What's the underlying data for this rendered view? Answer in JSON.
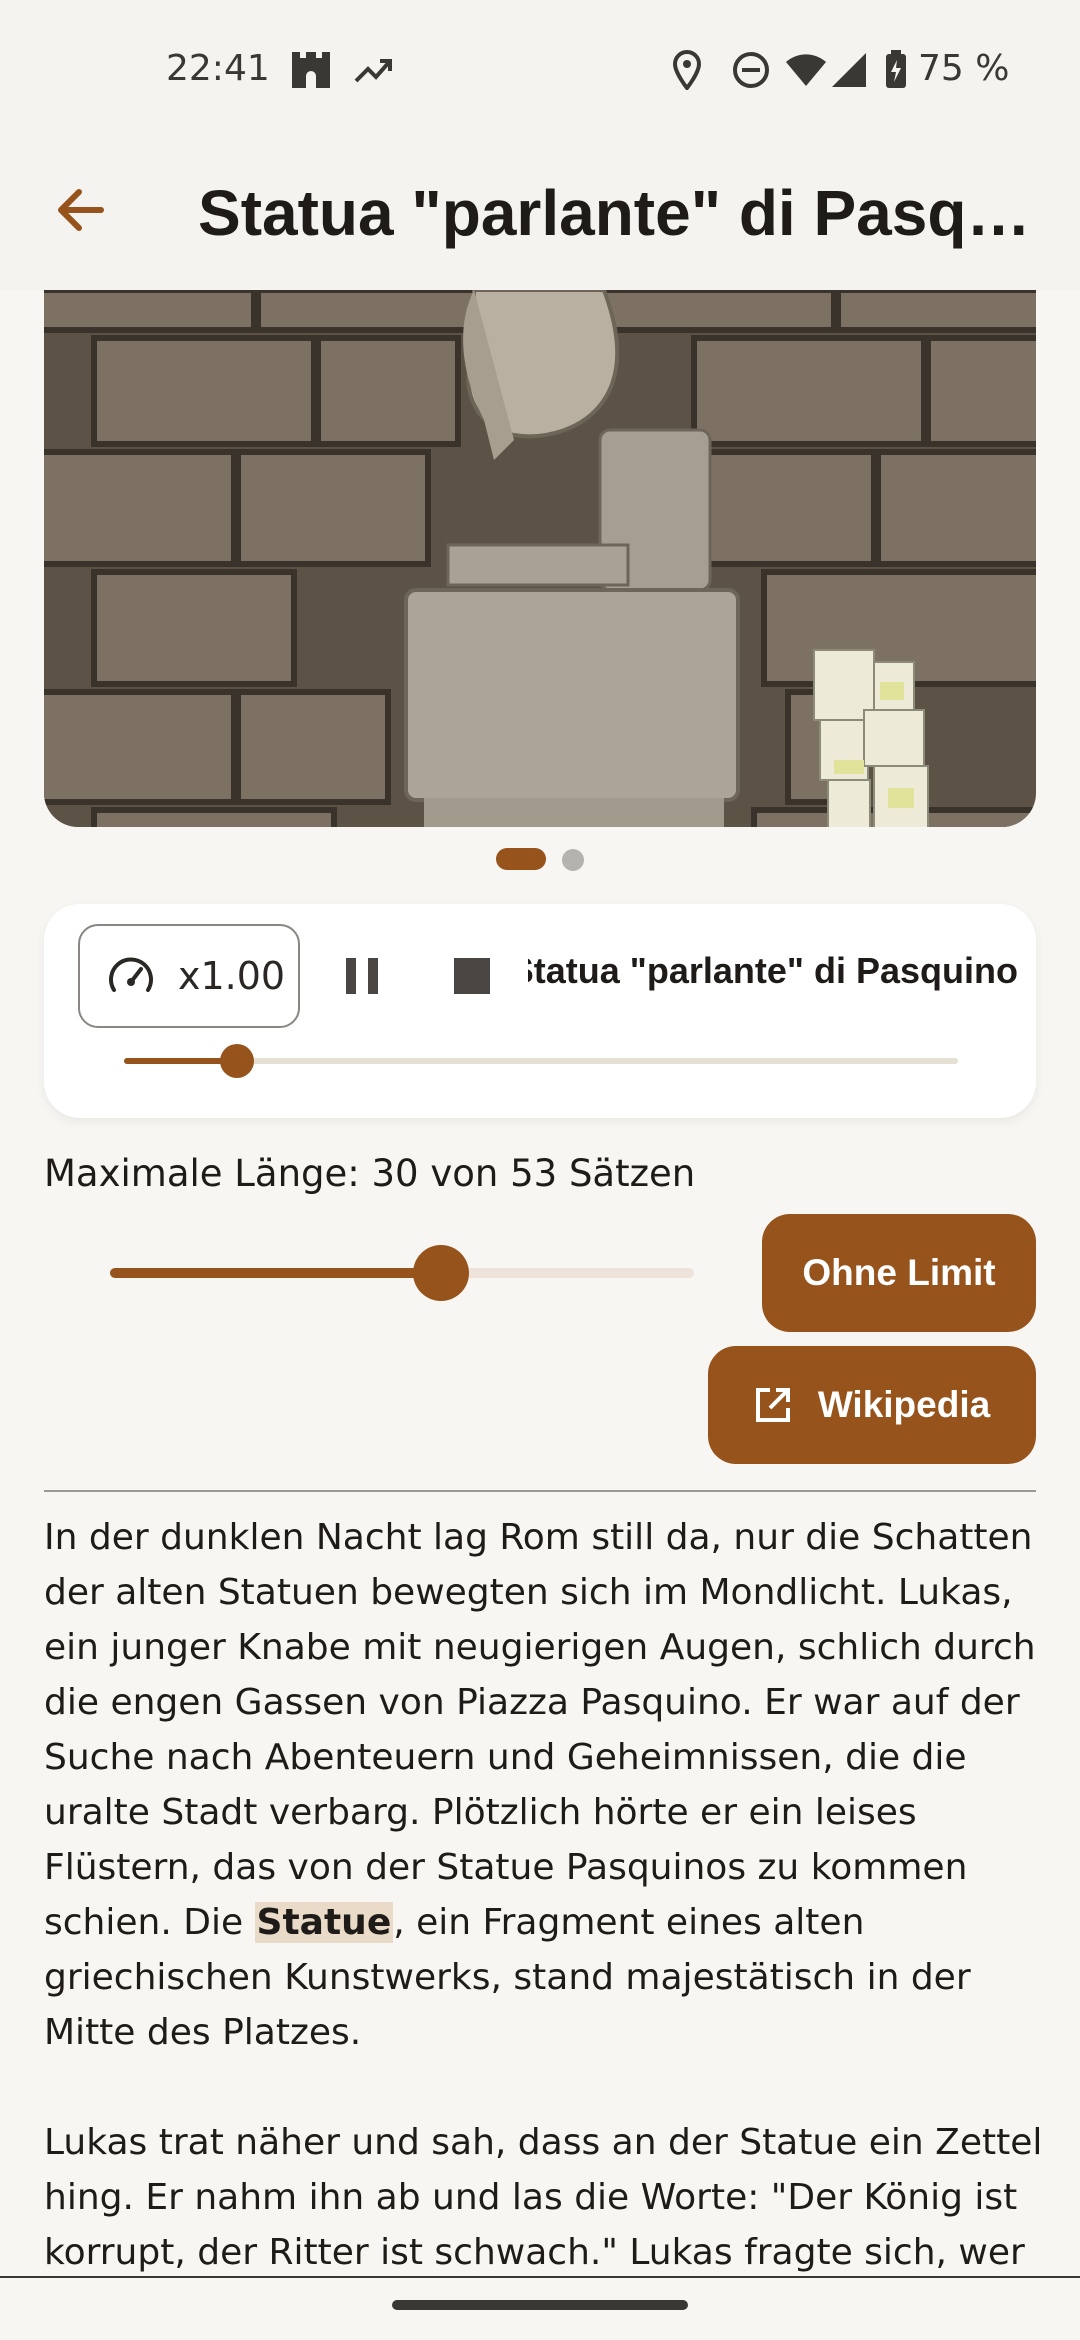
{
  "status_bar": {
    "time": "22:41",
    "battery": "75 %",
    "icons": [
      "castle-icon",
      "trending-icon",
      "location-icon",
      "dnd-icon",
      "wifi-icon",
      "signal-icon",
      "battery-icon"
    ]
  },
  "app_bar": {
    "title": "Statua \"parlante\" di Pasquino",
    "back_icon": "arrow-back-icon"
  },
  "carousel": {
    "page_count": 2,
    "active_page": 1
  },
  "player": {
    "speed": "x1.00",
    "now_playing": "Statua \"parlante\" di Pasquino",
    "progress": 0.135
  },
  "max_length": {
    "label": "Maximale Länge: 30 von 53 Sätzen",
    "value": 30,
    "total": 53
  },
  "buttons": {
    "no_limit": "Ohne Limit",
    "wikipedia": "Wikipedia"
  },
  "story": {
    "p1_before": "In der dunklen Nacht lag Rom still da, nur die Schatten der alten Statuen bewegten sich im Mondlicht. Lukas, ein junger Knabe mit neugierigen Augen, schlich durch die engen Gassen von Piazza Pasquino. Er war auf der Suche nach Abenteuern und Geheimnissen, die die uralte Stadt verbarg. Plötzlich hörte er ein leises Flüstern, das von der Statue Pasquinos zu kommen schien. Die ",
    "p1_highlight": "Statue",
    "p1_after": ", ein Fragment eines alten griechischen Kunstwerks, stand majestätisch in der Mitte des Platzes.",
    "p2": "Lukas trat näher und sah, dass an der Statue ein Zettel hing. Er nahm ihn ab und las die Worte: \"Der König ist korrupt, der Ritter ist schwach.\" Lukas fragte sich, wer"
  },
  "colors": {
    "accent": "#96531B",
    "background": "#F7F6F3",
    "highlight": "#EADBC8"
  }
}
